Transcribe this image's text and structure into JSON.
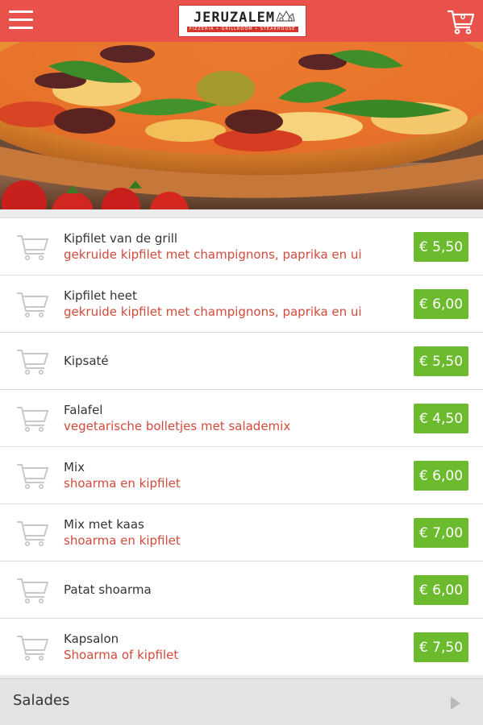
{
  "header": {
    "logo_name": "JERUZALEM",
    "logo_tagline": "PIZZERIA • GRILLROOM • STEAKHOUSE",
    "cart_count": "0",
    "brand_color": "#e8524a"
  },
  "menu": {
    "items": [
      {
        "name": "Kipfilet van de grill",
        "description": "gekruide kipfilet met champignons, paprika en ui",
        "price": "€ 5,50"
      },
      {
        "name": "Kipfilet heet",
        "description": "gekruide kipfilet met champignons, paprika en ui",
        "price": "€ 6,00"
      },
      {
        "name": "Kipsaté",
        "description": "",
        "price": "€ 5,50"
      },
      {
        "name": "Falafel",
        "description": "vegetarische bolletjes met salademix",
        "price": "€ 4,50"
      },
      {
        "name": "Mix",
        "description": "shoarma en kipfilet",
        "price": "€ 6,00"
      },
      {
        "name": "Mix met kaas",
        "description": "shoarma en kipfilet",
        "price": "€ 7,00"
      },
      {
        "name": "Patat shoarma",
        "description": "",
        "price": "€ 6,00"
      },
      {
        "name": "Kapsalon",
        "description": "Shoarma of kipfilet",
        "price": "€ 7,50"
      }
    ],
    "price_color": "#6cbb2e",
    "description_color": "#d24a3b"
  },
  "section": {
    "label": "Salades"
  }
}
